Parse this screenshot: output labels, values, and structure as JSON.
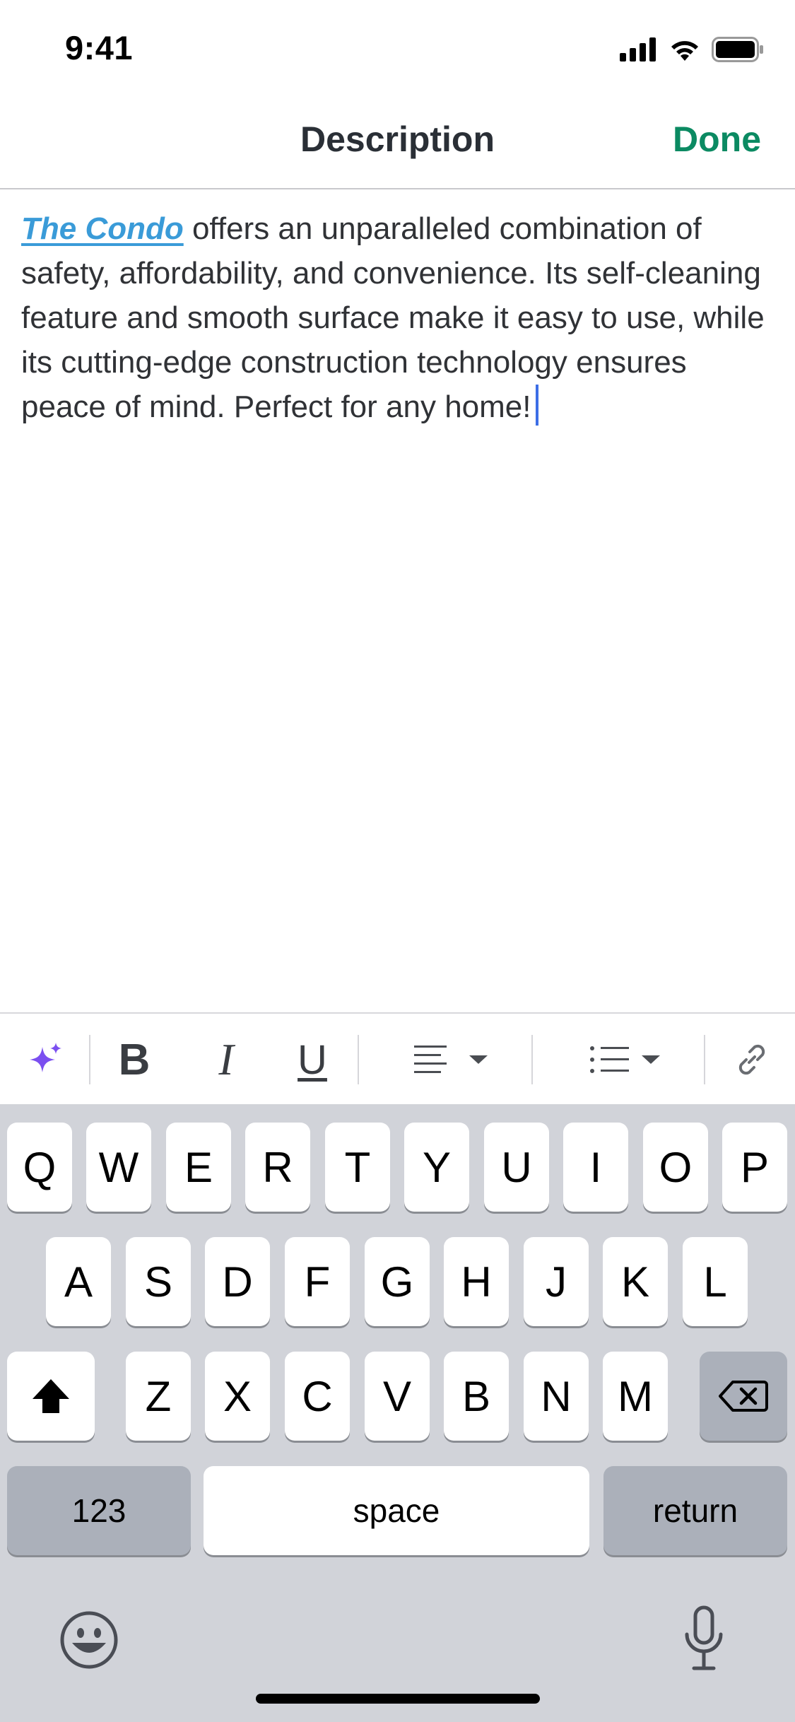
{
  "status_bar": {
    "time": "9:41"
  },
  "nav": {
    "title": "Description",
    "done_label": "Done"
  },
  "editor": {
    "link_text": "The Condo",
    "body_text": " offers an unparalleled combination of safety, affordability, and convenience. Its self-cleaning feature and smooth surface make it easy to use, while its cutting-edge construction technology ensures peace of mind. Perfect for any home!"
  },
  "toolbar": {
    "bold_label": "B",
    "italic_label": "I",
    "underline_label": "U"
  },
  "keyboard": {
    "row1": [
      "Q",
      "W",
      "E",
      "R",
      "T",
      "Y",
      "U",
      "I",
      "O",
      "P"
    ],
    "row2": [
      "A",
      "S",
      "D",
      "F",
      "G",
      "H",
      "J",
      "K",
      "L"
    ],
    "row3": [
      "Z",
      "X",
      "C",
      "V",
      "B",
      "N",
      "M"
    ],
    "numbers_label": "123",
    "space_label": "space",
    "return_label": "return"
  },
  "colors": {
    "accent_done": "#0b8a62",
    "link": "#3a9bd8",
    "caret": "#3c6ee6",
    "ai_sparkle": "#7b4ff0",
    "keyboard_bg": "#d1d3d9"
  },
  "icons": {
    "toolbar": [
      "sparkle-icon",
      "bold-icon",
      "italic-icon",
      "underline-icon",
      "align-icon",
      "list-icon",
      "link-icon"
    ],
    "keyboard": [
      "shift-icon",
      "backspace-icon",
      "emoji-icon",
      "microphone-icon"
    ]
  }
}
